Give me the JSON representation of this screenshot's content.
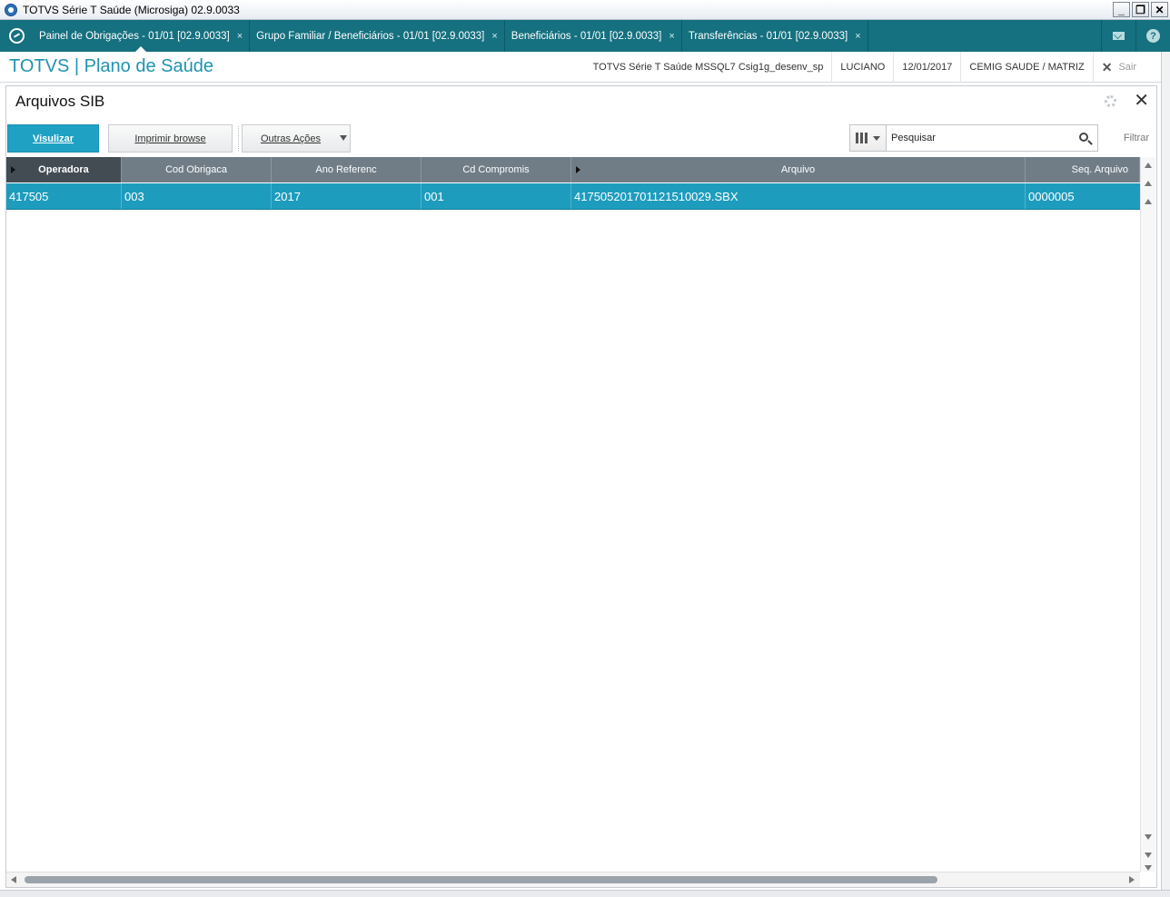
{
  "window": {
    "title": "TOTVS Série T Saúde (Microsiga) 02.9.0033",
    "minimize": "_",
    "restore": "❐",
    "close": "✕"
  },
  "tabs": [
    {
      "label": "Painel de Obrigações - 01/01 [02.9.0033]",
      "close": "×"
    },
    {
      "label": "Grupo Familiar / Beneficiários - 01/01 [02.9.0033]",
      "close": "×"
    },
    {
      "label": "Beneficiários - 01/01 [02.9.0033]",
      "close": "×"
    },
    {
      "label": "Transferências - 01/01 [02.9.0033]",
      "close": "×"
    }
  ],
  "header": {
    "brand": "TOTVS | Plano de Saúde",
    "environment": "TOTVS Série T Saúde MSSQL7 Csig1g_desenv_sp",
    "user": "LUCIANO",
    "date": "12/01/2017",
    "company": "CEMIG SAUDE / MATRIZ",
    "sair": "Sair"
  },
  "panel": {
    "title": "Arquivos SIB",
    "close": "✕",
    "buttons": {
      "visualizar": "Visulizar",
      "imprimir": "Imprimir browse",
      "outras": "Outras Ações"
    },
    "search_placeholder": "Pesquisar",
    "filtrar": "Filtrar"
  },
  "grid": {
    "columns": [
      "Operadora",
      "Cod Obrigaca",
      "Ano Referenc",
      "Cd Compromis",
      "Arquivo",
      "Seq. Arquivo"
    ],
    "rows": [
      [
        "417505",
        "003",
        "2017",
        "001",
        "417505201701121510029.SBX",
        "0000005"
      ]
    ]
  },
  "icons": {
    "home": "home-icon",
    "mail": "mail-icon",
    "help": "help-icon",
    "gear": "gear-icon",
    "search": "search-icon"
  },
  "colors": {
    "tabbar": "#15707f",
    "accent": "#1fa1c3",
    "grid_header": "#707d87",
    "selected_row": "#1e9cbd"
  }
}
